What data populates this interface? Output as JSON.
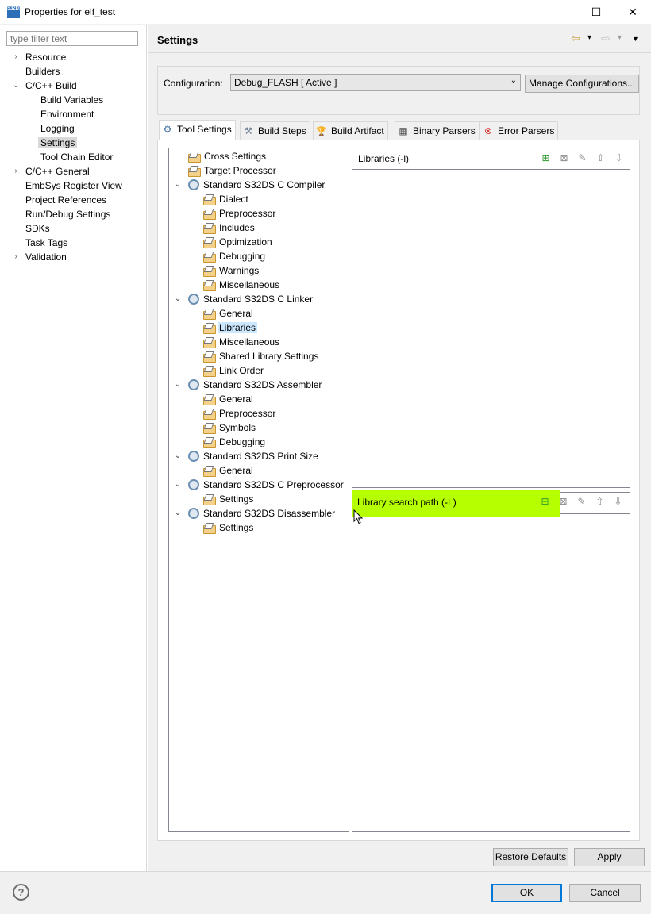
{
  "window": {
    "title": "Properties for elf_test",
    "app_icon_text": "S32DS",
    "minimize": "—",
    "maximize": "☐",
    "close": "✕"
  },
  "filter": {
    "placeholder": "type filter text"
  },
  "nav": {
    "items": [
      {
        "label": "Resource",
        "level": 0,
        "chevron": "›"
      },
      {
        "label": "Builders",
        "level": 0,
        "chevron": ""
      },
      {
        "label": "C/C++ Build",
        "level": 0,
        "chevron": "⌄"
      },
      {
        "label": "Build Variables",
        "level": 1,
        "chevron": ""
      },
      {
        "label": "Environment",
        "level": 1,
        "chevron": ""
      },
      {
        "label": "Logging",
        "level": 1,
        "chevron": ""
      },
      {
        "label": "Settings",
        "level": 1,
        "chevron": "",
        "selected": true
      },
      {
        "label": "Tool Chain Editor",
        "level": 1,
        "chevron": ""
      },
      {
        "label": "C/C++ General",
        "level": 0,
        "chevron": "›"
      },
      {
        "label": "EmbSys Register View",
        "level": 0,
        "chevron": ""
      },
      {
        "label": "Project References",
        "level": 0,
        "chevron": ""
      },
      {
        "label": "Run/Debug Settings",
        "level": 0,
        "chevron": ""
      },
      {
        "label": "SDKs",
        "level": 0,
        "chevron": ""
      },
      {
        "label": "Task Tags",
        "level": 0,
        "chevron": ""
      },
      {
        "label": "Validation",
        "level": 0,
        "chevron": "›"
      }
    ]
  },
  "header": {
    "title": "Settings",
    "back_icon": "⇦",
    "forward_icon": "⇨",
    "dropdown_icon": "▾",
    "menu_icon": "▼"
  },
  "config": {
    "label": "Configuration:",
    "value": "Debug_FLASH  [ Active ]",
    "arrow": "⌄",
    "manage_label": "Manage Configurations..."
  },
  "tabs": [
    {
      "label": "Tool Settings",
      "icon": "⚙",
      "active": true
    },
    {
      "label": "Build Steps",
      "icon": "⚒"
    },
    {
      "label": "Build Artifact",
      "icon": "🏆"
    },
    {
      "label": "Binary Parsers",
      "icon": "▦"
    },
    {
      "label": "Error Parsers",
      "icon": "⊗"
    }
  ],
  "tree": {
    "items": [
      {
        "label": "Cross Settings",
        "level": 0,
        "type": "folder"
      },
      {
        "label": "Target Processor",
        "level": 0,
        "type": "folder"
      },
      {
        "label": "Standard S32DS C Compiler",
        "level": 0,
        "type": "tool",
        "expanded": true
      },
      {
        "label": "Dialect",
        "level": 1,
        "type": "folder"
      },
      {
        "label": "Preprocessor",
        "level": 1,
        "type": "folder"
      },
      {
        "label": "Includes",
        "level": 1,
        "type": "folder"
      },
      {
        "label": "Optimization",
        "level": 1,
        "type": "folder"
      },
      {
        "label": "Debugging",
        "level": 1,
        "type": "folder"
      },
      {
        "label": "Warnings",
        "level": 1,
        "type": "folder"
      },
      {
        "label": "Miscellaneous",
        "level": 1,
        "type": "folder"
      },
      {
        "label": "Standard S32DS C Linker",
        "level": 0,
        "type": "tool",
        "expanded": true
      },
      {
        "label": "General",
        "level": 1,
        "type": "folder"
      },
      {
        "label": "Libraries",
        "level": 1,
        "type": "folder",
        "selected": true
      },
      {
        "label": "Miscellaneous",
        "level": 1,
        "type": "folder"
      },
      {
        "label": "Shared Library Settings",
        "level": 1,
        "type": "folder"
      },
      {
        "label": "Link Order",
        "level": 1,
        "type": "folder"
      },
      {
        "label": "Standard S32DS Assembler",
        "level": 0,
        "type": "tool",
        "expanded": true
      },
      {
        "label": "General",
        "level": 1,
        "type": "folder"
      },
      {
        "label": "Preprocessor",
        "level": 1,
        "type": "folder"
      },
      {
        "label": "Symbols",
        "level": 1,
        "type": "folder"
      },
      {
        "label": "Debugging",
        "level": 1,
        "type": "folder"
      },
      {
        "label": "Standard S32DS Print Size",
        "level": 0,
        "type": "tool",
        "expanded": true
      },
      {
        "label": "General",
        "level": 1,
        "type": "folder"
      },
      {
        "label": "Standard S32DS C Preprocessor",
        "level": 0,
        "type": "tool",
        "expanded": true
      },
      {
        "label": "Settings",
        "level": 1,
        "type": "folder"
      },
      {
        "label": "Standard S32DS Disassembler",
        "level": 0,
        "type": "tool",
        "expanded": true
      },
      {
        "label": "Settings",
        "level": 1,
        "type": "folder"
      }
    ]
  },
  "libraries": {
    "title": "Libraries (-l)",
    "tools": {
      "add": "⊞",
      "delete": "⊠",
      "edit": "✎",
      "up": "⇧",
      "down": "⇩"
    }
  },
  "library_paths": {
    "title": "Library search path (-L)",
    "tools": {
      "add": "⊞",
      "delete": "⊠",
      "edit": "✎",
      "up": "⇧",
      "down": "⇩"
    }
  },
  "buttons": {
    "restore_defaults": "Restore Defaults",
    "apply": "Apply",
    "ok": "OK",
    "cancel": "Cancel",
    "help": "?"
  },
  "colors": {
    "highlight": "#b6ff00",
    "selection": "#cce8ff"
  }
}
